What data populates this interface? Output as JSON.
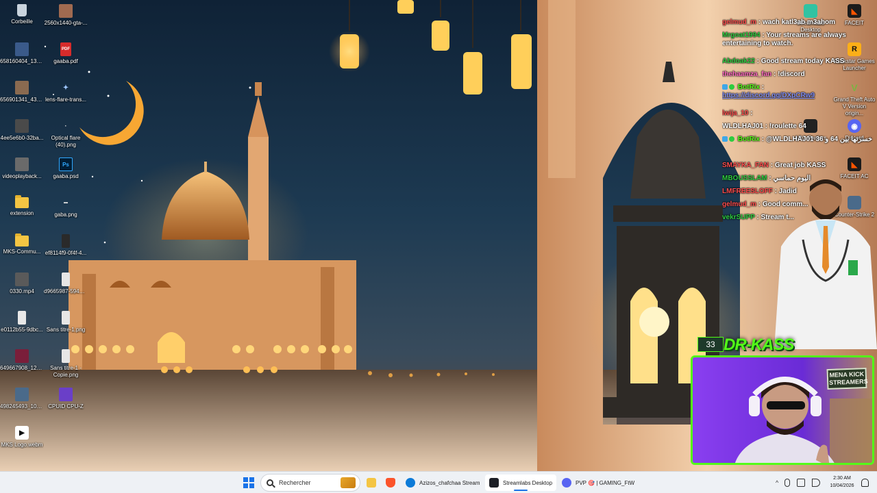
{
  "desktop": {
    "icons_left": [
      {
        "label": "Corbeille",
        "icon": "recycle-bin-icon"
      },
      {
        "label": "658160404_134...",
        "icon": "video-thumb-icon"
      },
      {
        "label": "656901341_430...",
        "icon": "image-thumb-icon"
      },
      {
        "label": "4ee5e6b0-32ba...",
        "icon": "image-thumb-icon"
      },
      {
        "label": "videoplayback...",
        "icon": "video-thumb-icon"
      },
      {
        "label": "extension",
        "icon": "folder-icon"
      },
      {
        "label": "MKS-Commu...",
        "icon": "folder-icon"
      },
      {
        "label": "0330.mp4",
        "icon": "video-thumb-icon"
      },
      {
        "label": "e0112b55-9dbc...",
        "icon": "image-thumb-icon"
      },
      {
        "label": "649667908_123...",
        "icon": "image-thumb-icon"
      },
      {
        "label": "498245493_102...",
        "icon": "image-thumb-icon"
      },
      {
        "label": "MKS Logo.webm",
        "icon": "video-file-icon"
      }
    ],
    "icons_mid": [
      {
        "label": "2560x1440-gta-...",
        "icon": "image-thumb-icon"
      },
      {
        "label": "gaaba.pdf",
        "icon": "pdf-icon"
      },
      {
        "label": "lens-flare-trans...",
        "icon": "image-thumb-icon"
      },
      {
        "label": "Optical flare (40).png",
        "icon": "image-thumb-icon"
      },
      {
        "label": "gaaba.psd",
        "icon": "photoshop-icon"
      },
      {
        "label": "gaba.png",
        "icon": "image-thumb-icon"
      },
      {
        "label": "ef8114f9-0f4f-4...",
        "icon": "image-thumb-icon"
      },
      {
        "label": "d9665987-5944-...",
        "icon": "image-thumb-icon"
      },
      {
        "label": "Sans titre-1.png",
        "icon": "image-thumb-icon"
      },
      {
        "label": "Sans titre-1 - Copie.png",
        "icon": "image-thumb-icon"
      },
      {
        "label": "CPUID CPU-Z",
        "icon": "cpuz-icon"
      }
    ],
    "icons_right": [
      {
        "label": "FACEIT",
        "icon": "faceit-icon",
        "color": "#ff5500"
      },
      {
        "label": "Rockstar Games Launcher",
        "icon": "rockstar-icon",
        "color": "#fcaf17"
      },
      {
        "label": "Grand Theft Auto V Version origin...",
        "icon": "gta-icon",
        "color": "#7cb342"
      },
      {
        "label": "Discord",
        "icon": "discord-icon",
        "color": "#5865f2"
      },
      {
        "label": "FACEIT AC",
        "icon": "faceit-ac-icon",
        "color": "#ff5500"
      },
      {
        "label": "Counter-Strike 2",
        "icon": "cs2-icon",
        "color": "#4a6a8a"
      }
    ],
    "icons_chatcol": [
      {
        "label": "Streamlabs Desktop",
        "icon": "streamlabs-icon",
        "color": "#31c3a2"
      },
      {
        "label": "ARC Raiders",
        "icon": "arc-raiders-icon",
        "color": "#222222"
      }
    ]
  },
  "chat": {
    "messages": [
      {
        "user": "gelmud_m",
        "text": "wach katl3ab m3ahom",
        "user_color": "#ff4d4d"
      },
      {
        "user": "Mrgoat1994",
        "text": "Your streams are always entertaining to watch.",
        "user_color": "#2ecc40"
      },
      {
        "user": "Abdoak22",
        "text": "Good stream today KASS",
        "user_color": "#2ecc40"
      },
      {
        "user": "thehaamza_fan",
        "text": "!discord",
        "user_color": "#ff6ac1"
      },
      {
        "user": "BotRix",
        "text": "https://discord.gg/DXpCRw9",
        "user_color": "#53fc18",
        "badge": true,
        "link": true
      },
      {
        "user": "lwija_10",
        "text": "",
        "user_color": "#ff4d4d"
      },
      {
        "user": "WLDLHAJ01",
        "text": "!roulette 64",
        "user_color": "#ffffff"
      },
      {
        "user": "BotRix",
        "text": "@WLDLHAJ01 خسرتها بين 64 و 36",
        "user_color": "#53fc18",
        "badge": true
      },
      {
        "user": "SMAYKA_FAN",
        "text": "Great job KASS",
        "user_color": "#ff4d4d"
      },
      {
        "user": "MBOUSSLAM",
        "text": "اليوم حماسي",
        "user_color": "#2ecc40"
      },
      {
        "user": "LMFREESLOFF",
        "text": "Jadid",
        "user_color": "#ff4d4d"
      },
      {
        "user": "gelmud_m",
        "text": "Good comm...",
        "user_color": "#ff4d4d"
      },
      {
        "user": "vekrSUPP",
        "text": "Stream t...",
        "user_color": "#2ecc40"
      }
    ]
  },
  "stream": {
    "viewer_count": "33",
    "streamer_name": "DR-KASS",
    "webcam_badge": "MENA KICK STREAMERS",
    "accent": "#53fc18"
  },
  "taskbar": {
    "search_placeholder": "Rechercher",
    "apps": [
      {
        "label": "",
        "icon": "file-explorer-icon",
        "color": "#f4c543"
      },
      {
        "label": "",
        "icon": "brave-icon",
        "color": "#fb542b"
      },
      {
        "label": "Azizos_chafchaa Stream",
        "icon": "edge-icon",
        "color": "#0c7bd8"
      },
      {
        "label": "Streamlabs Desktop",
        "icon": "streamlabs-icon",
        "color": "#1d1f26"
      },
      {
        "label": "PVP 🎯 | GAMING_FtW",
        "icon": "discord-icon",
        "color": "#5865f2"
      }
    ],
    "time": "2:30 AM",
    "date": "10/04/2026"
  }
}
